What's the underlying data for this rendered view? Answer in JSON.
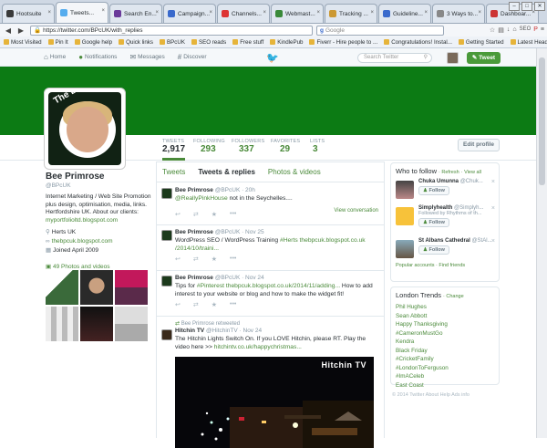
{
  "browser": {
    "tabs": [
      {
        "label": "Hootsuite",
        "color": "#3a3a3a"
      },
      {
        "label": "Tweets...",
        "color": "#55acee",
        "active": true
      },
      {
        "label": "Search En...",
        "color": "#6a3a9a"
      },
      {
        "label": "Campaign...",
        "color": "#3a6acc"
      },
      {
        "label": "Channels...",
        "color": "#d33"
      },
      {
        "label": "Webmast...",
        "color": "#3a8a3a"
      },
      {
        "label": "Tracking ...",
        "color": "#c93"
      },
      {
        "label": "Guideline...",
        "color": "#3a6acc"
      },
      {
        "label": "3 Ways to...",
        "color": "#888"
      },
      {
        "label": "Dashboar...",
        "color": "#c33"
      }
    ],
    "url": "https://twitter.com/BPcUK/with_replies",
    "search_placeholder": "Google",
    "bookmarks": [
      "Most Visited",
      "Pin It",
      "Google help",
      "Quick links",
      "BPcUK",
      "SEO reads",
      "Free stuff",
      "KindlePub",
      "Fiverr - Hire people to ...",
      "Congratulations! Instal...",
      "Getting Started",
      "Latest Headlines"
    ]
  },
  "twitter_header": {
    "nav": [
      "Home",
      "Notifications",
      "Messages",
      "Discover"
    ],
    "search_placeholder": "Search Twitter",
    "tweet_button": "Tweet"
  },
  "stats": [
    {
      "label": "TWEETS",
      "value": "2,917"
    },
    {
      "label": "FOLLOWING",
      "value": "293"
    },
    {
      "label": "FOLLOWERS",
      "value": "337"
    },
    {
      "label": "FAVORITES",
      "value": "29"
    },
    {
      "label": "LISTS",
      "value": "3"
    }
  ],
  "edit_profile": "Edit profile",
  "profile": {
    "avatar_text": "The BPC",
    "name": "Bee Primrose",
    "handle": "@BPcUK",
    "bio": "Internet Marketing / Web Site Promotion plus design, optimisation, media, links. Hertfordshire UK. About our clients: ",
    "bio_link": "myportfolioltd.blogspot.com",
    "location": "Herts UK",
    "website": "thebpcuk.blogspot.com",
    "joined": "Joined April 2009",
    "photos": "49 Photos and videos"
  },
  "timeline": {
    "tabs": [
      "Tweets",
      "Tweets & replies",
      "Photos & videos"
    ],
    "tweets": [
      {
        "name": "Bee Primrose",
        "handle": "@BPcUK · 20h",
        "text_link": "@ReallyPinkHouse",
        "text": " not in the Seychelles....",
        "view": "View conversation"
      },
      {
        "name": "Bee Primrose",
        "handle": "@BPcUK · Nov 25",
        "text": "WordPress SEO / WordPress Training ",
        "text_link": "#Herts thebpcuk.blogspot.co.uk /2014/10/traini..."
      },
      {
        "name": "Bee Primrose",
        "handle": "@BPcUK · Nov 24",
        "text_pre": "Tips for ",
        "text_link": "#Pinterest thebpcuk.blogspot.co.uk/2014/11/adding...",
        "text": "  How to add interest to your website or blog and how to make the widget fit!"
      },
      {
        "retweeted": "Bee Primrose retweeted",
        "name": "Hitchin TV",
        "handle": "@HitchinTV · Nov 24",
        "text": "The Hitchin Lights Switch On. If you LOVE Hitchin, please RT. Play the video here >> ",
        "text_link": "hitchintv.co.uk/happychristmas...",
        "media_title": "Hitchin TV"
      }
    ]
  },
  "who_to_follow": {
    "title": "Who to follow",
    "refresh": "· Refresh",
    "view_all": "· View all",
    "people": [
      {
        "name": "Chuka Umunna",
        "handle": "@Chuk...",
        "follow": "Follow"
      },
      {
        "name": "Simplyhealth",
        "handle": "@Simplyh...",
        "note": "Followed by Rhythms of th...",
        "follow": "Follow"
      },
      {
        "name": "St Albans Cathedral",
        "handle": "@StAl...",
        "follow": "Follow"
      }
    ],
    "footer": "Popular accounts · Find friends"
  },
  "trends": {
    "title": "London Trends",
    "change": "· Change",
    "items": [
      "Phil Hughes",
      "Sean Abbott",
      "Happy Thanksgiving",
      "#CameronMustGo",
      "Kendra",
      "Black Friday",
      "#CricketFamily",
      "#LondonToFerguson",
      "#ImACeleb",
      "East Coast"
    ]
  },
  "footer": "© 2014 Twitter   About   Help   Ads info"
}
